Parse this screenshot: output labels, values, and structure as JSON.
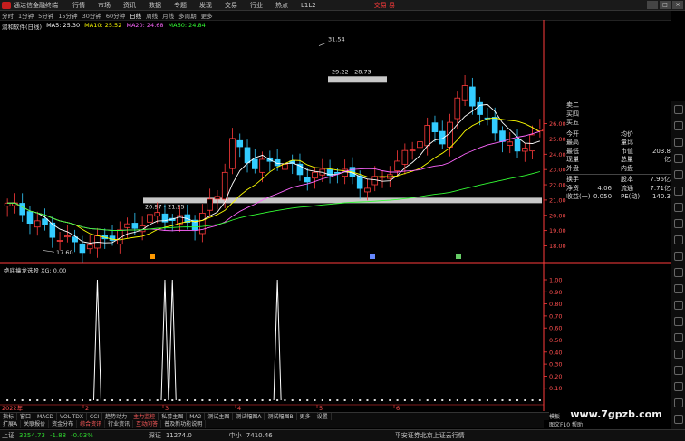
{
  "titlebar": {
    "app_title": "通达信金融终端",
    "menu": [
      "行情",
      "市场",
      "资讯",
      "数据",
      "专题",
      "发现",
      "交易",
      "行业",
      "热点",
      "L1L2"
    ],
    "broker": "交易 易",
    "controls": [
      "-",
      "□",
      "×"
    ]
  },
  "periodbar": {
    "items": [
      "分时",
      "1分钟",
      "5分钟",
      "15分钟",
      "30分钟",
      "60分钟",
      "日线",
      "周线",
      "月线",
      "多周期",
      "更多"
    ],
    "active": "日线"
  },
  "indicator_line": {
    "name": "润和软件(日线)",
    "ma5": "MA5: 25.30",
    "ma10": "MA10: 25.52",
    "ma20": "MA20: 24.68",
    "ma60": "MA60: 24.84",
    "colors": {
      "name": "#dddddd",
      "ma5": "#ffffff",
      "ma10": "#ffff00",
      "ma20": "#ff66ff",
      "ma60": "#33ff33"
    }
  },
  "main_chart": {
    "price_ticks": [
      "26.00",
      "25.00",
      "24.00",
      "23.00",
      "22.00",
      "21.00",
      "20.00",
      "19.00",
      "18.00"
    ],
    "high_label": "31.54",
    "low_label": "17.60",
    "band_upper_label": "29.22 - 28.73",
    "band_lower_label": "20.97 - 21.25",
    "markers": [
      "柱",
      "▣",
      "涨"
    ],
    "colors": {
      "up": "#ff3b3b",
      "down": "#33ccff",
      "ma5": "#ffffff",
      "ma10": "#ffff00",
      "ma20": "#ff66ff",
      "ma60": "#33ff33",
      "band": "#c8c8c8",
      "axis": "#ff3b3b"
    }
  },
  "sub_chart": {
    "title": "绝底擒龙选股 XG: 0.00",
    "ticks": [
      "1.00",
      "0.90",
      "0.80",
      "0.70",
      "0.60",
      "0.50",
      "0.40",
      "0.30",
      "0.20",
      "0.10"
    ],
    "date_label": "2022年",
    "month_labels": [
      "2",
      "3",
      "4",
      "5",
      "6"
    ],
    "signals": [
      0,
      0,
      0,
      0,
      0,
      0,
      0,
      0,
      0,
      0,
      0,
      0,
      1,
      0,
      0,
      0,
      0,
      0,
      0,
      0,
      0,
      1,
      1,
      0,
      0,
      0,
      0,
      0,
      0,
      0,
      0,
      0,
      0,
      0,
      0,
      0,
      1,
      0,
      0,
      0,
      0,
      0,
      0,
      0,
      0,
      0,
      0,
      0,
      0,
      0,
      0,
      0,
      0,
      0,
      0,
      0,
      0,
      0,
      0,
      0,
      0,
      0,
      0,
      0,
      0,
      0,
      0,
      0,
      0,
      0,
      0,
      0
    ]
  },
  "right_panel": {
    "top_labels": [
      "卖二",
      "买四",
      "买五"
    ],
    "rows": [
      {
        "l1": "今开",
        "v1": "",
        "l2": "均价",
        "v2": ""
      },
      {
        "l1": "最高",
        "v1": "",
        "l2": "量比",
        "v2": ""
      },
      {
        "l1": "最低",
        "v1": "",
        "l2": "市值",
        "v2": "203.8亿"
      },
      {
        "l1": "现量",
        "v1": "",
        "l2": "总量",
        "v2": ""
      },
      {
        "l1": "外盘",
        "v1": "",
        "l2": "内盘",
        "v2": ""
      }
    ],
    "rows2": [
      {
        "l1": "换手",
        "v1": "",
        "l2": "股本",
        "v2": "7.96亿"
      },
      {
        "l1": "净资",
        "v1": "4.06",
        "l2": "流通",
        "v2": "7.71亿"
      },
      {
        "l1": "收益(一)",
        "v1": "0.050",
        "l2": "PE(动)",
        "v2": "140.3"
      }
    ]
  },
  "tabs": {
    "row1": [
      "指标",
      "窗口",
      "MACD",
      "VOL-TDX",
      "CCI",
      "趋势动力",
      "主力监控",
      "私募主图",
      "MA2",
      "测试主图",
      "测试幅图A",
      "测试幅图B",
      "更多",
      "设置"
    ],
    "row1_active": "主力监控",
    "row2": [
      "扩展A",
      "关联报价",
      "资金分布",
      "综合资讯",
      "行业资讯",
      "互动问答",
      "普及新功能说明"
    ],
    "row2_highlight": [
      "综合资讯",
      "互动问答"
    ],
    "right1": "模板",
    "right2": "图文F10 帮助"
  },
  "statusbar": {
    "items": [
      {
        "label": "上证",
        "value": "3254.73",
        "change": "-1.88",
        "pct": "-0.03%"
      },
      {
        "label": "深证",
        "value": "11274.0",
        "change": "",
        "pct": ""
      },
      {
        "label": "中小",
        "value": "7410.46",
        "change": "",
        "pct": ""
      }
    ],
    "news": "平安证券北京上证云行情"
  },
  "watermark": "www.7gpzb.com"
}
